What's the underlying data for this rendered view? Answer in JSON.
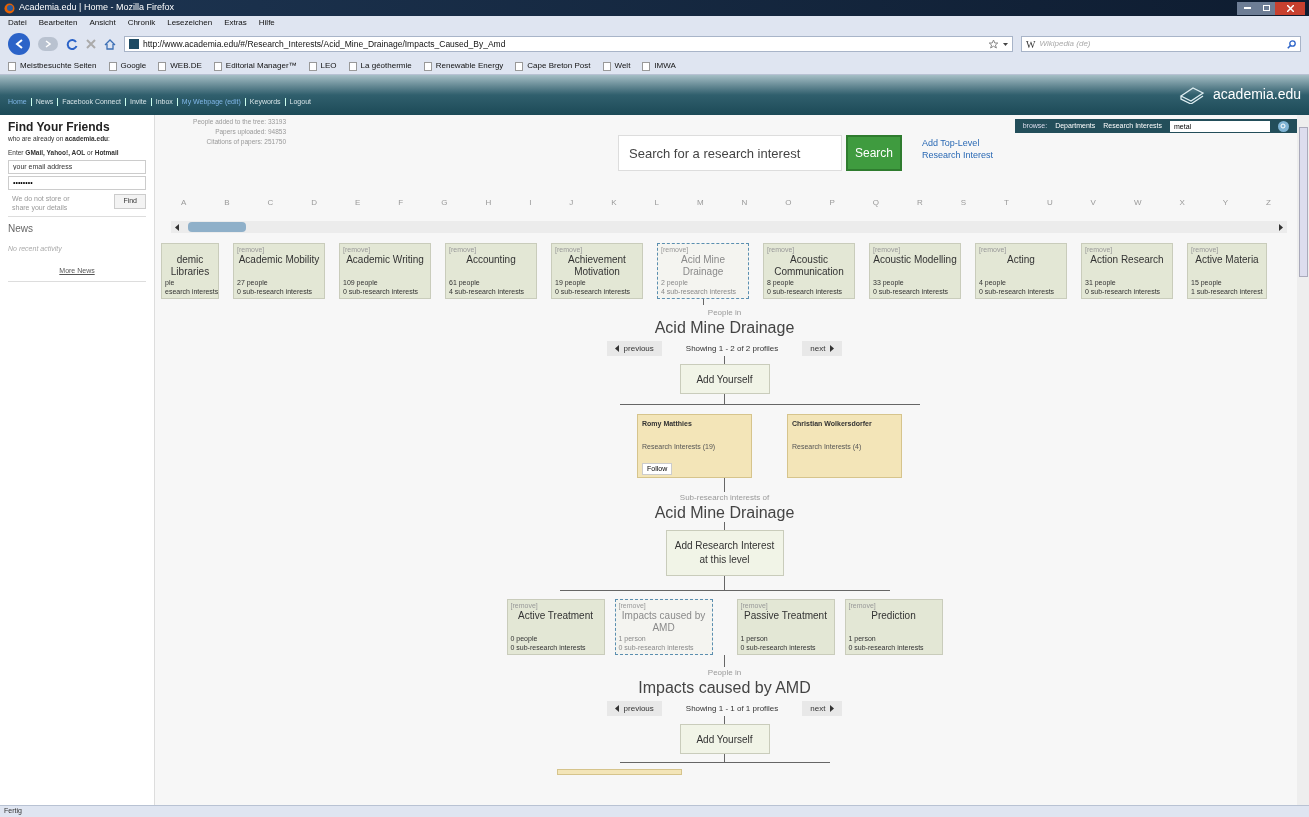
{
  "browser": {
    "title": "Academia.edu | Home - Mozilla Firefox",
    "menu": [
      "Datei",
      "Bearbeiten",
      "Ansicht",
      "Chronik",
      "Lesezeichen",
      "Extras",
      "Hilfe"
    ],
    "url": "http://www.academia.edu/#/Research_Interests/Acid_Mine_Drainage/Impacts_Caused_By_Amd",
    "search_engine": "W",
    "search_placeholder": "Wikipedia (de)",
    "bookmarks": [
      "Meistbesuchte Seiten",
      "Google",
      "WEB.DE",
      "Editorial Manager™",
      "LEO",
      "La géothermie",
      "Renewable Energy",
      "Cape Breton Post",
      "Welt",
      "IMWA"
    ],
    "status": "Fertig"
  },
  "site": {
    "nav": [
      {
        "label": "Home",
        "highlighted": true
      },
      {
        "label": "News",
        "highlighted": false
      },
      {
        "label": "Facebook Connect",
        "highlighted": false
      },
      {
        "label": "Invite",
        "highlighted": false
      },
      {
        "label": "Inbox",
        "highlighted": false
      },
      {
        "label": "My Webpage (edit)",
        "highlighted": true
      },
      {
        "label": "Keywords",
        "highlighted": false
      },
      {
        "label": "Logout",
        "highlighted": false
      }
    ],
    "logo": "academia.edu"
  },
  "sidebar": {
    "title": "Find Your Friends",
    "subtitle": "who are already on **academia.edu**:",
    "prompt": "Enter **GMail, Yahoo!, AOL** or **Hotmail**",
    "email_placeholder": "your email address",
    "password": "••••••••",
    "note": "We do not store or share your details",
    "find": "Find",
    "news_title": "News",
    "news_empty": "No recent activity",
    "more_news": "More News"
  },
  "stats": [
    "People added to the tree: 33193",
    "Papers uploaded: 94853",
    "Citations of papers: 251750"
  ],
  "browse": {
    "label": "browse:",
    "links": [
      "Departments",
      "Research Interests"
    ],
    "value": "metal"
  },
  "search": {
    "placeholder": "Search for a research interest",
    "button": "Search",
    "add_link": "Add Top-Level Research Interest"
  },
  "letters": [
    "A",
    "B",
    "C",
    "D",
    "E",
    "F",
    "G",
    "H",
    "I",
    "J",
    "K",
    "L",
    "M",
    "N",
    "O",
    "P",
    "Q",
    "R",
    "S",
    "T",
    "U",
    "V",
    "W",
    "X",
    "Y",
    "Z"
  ],
  "interests": [
    {
      "title": "demic Libraries",
      "people": "ple",
      "sub": "esearch interests",
      "selected": false
    },
    {
      "title": "Academic Mobility",
      "tag": "[remove]",
      "people": "27 people",
      "sub": "0 sub-research interests",
      "selected": false
    },
    {
      "title": "Academic Writing",
      "tag": "[remove]",
      "people": "109 people",
      "sub": "0 sub-research interests",
      "selected": false
    },
    {
      "title": "Accounting",
      "tag": "[remove]",
      "people": "61 people",
      "sub": "4 sub-research interests",
      "selected": false
    },
    {
      "title": "Achievement Motivation",
      "tag": "[remove]",
      "people": "19 people",
      "sub": "0 sub-research interests",
      "selected": false
    },
    {
      "title": "Acid Mine Drainage",
      "tag": "[remove]",
      "people": "2 people",
      "sub": "4 sub-research interests",
      "selected": true
    },
    {
      "title": "Acoustic Communication",
      "tag": "[remove]",
      "people": "8 people",
      "sub": "0 sub-research interests",
      "selected": false
    },
    {
      "title": "Acoustic Modelling",
      "tag": "[remove]",
      "people": "33 people",
      "sub": "0 sub-research interests",
      "selected": false
    },
    {
      "title": "Acting",
      "tag": "[remove]",
      "people": "4 people",
      "sub": "0 sub-research interests",
      "selected": false
    },
    {
      "title": "Action Research",
      "tag": "[remove]",
      "people": "31 people",
      "sub": "0 sub-research interests",
      "selected": false
    },
    {
      "title": "Active Materia",
      "tag": "[remove]",
      "people": "15 people",
      "sub": "1 sub-research interest",
      "selected": false
    }
  ],
  "people": {
    "heading": "People in",
    "name": "Acid Mine Drainage",
    "previous": "previous",
    "showing": "Showing 1 - 2 of 2 profiles",
    "next": "next",
    "add": "Add Yourself",
    "profiles": [
      {
        "name": "Romy Matthies",
        "interests": "Research Interests (19)",
        "follow": "Follow"
      },
      {
        "name": "Christian Wolkersdorfer",
        "interests": "Research Interests (4)"
      }
    ]
  },
  "sub": {
    "heading": "Sub-research interests of",
    "name": "Acid Mine Drainage",
    "add": "Add Research Interest at this level",
    "children": [
      {
        "title": "Active Treatment",
        "tag": "[remove]",
        "people": "0 people",
        "sub": "0 sub-research interests",
        "selected": false
      },
      {
        "title": "Impacts caused by AMD",
        "tag": "[remove]",
        "people": "1 person",
        "sub": "0 sub-research interests",
        "selected": true
      },
      {
        "title": "Passive Treatment",
        "tag": "[remove]",
        "people": "1 person",
        "sub": "0 sub-research interests",
        "selected": false
      },
      {
        "title": "Prediction",
        "tag": "[remove]",
        "people": "1 person",
        "sub": "0 sub-research interests",
        "selected": false
      }
    ]
  },
  "people2": {
    "heading": "People in",
    "name": "Impacts caused by AMD",
    "previous": "previous",
    "showing": "Showing 1 - 1 of 1 profiles",
    "next": "next",
    "add": "Add Yourself"
  }
}
